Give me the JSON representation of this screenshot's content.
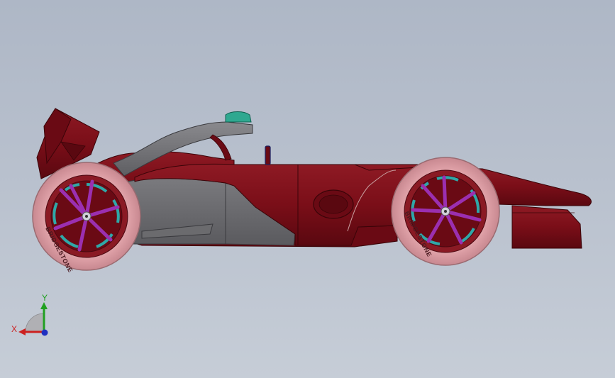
{
  "scene": {
    "subject": "formula-car-side-view"
  },
  "colors": {
    "background_top": "#aeb7c6",
    "background_bottom": "#c6cdd7",
    "body_red": "#7a0e18",
    "body_red_dark": "#5a0810",
    "body_red_highlight": "#9a2a32",
    "sidepod_gray": "#6b6b6e",
    "halo_gray": "#7c7c80",
    "tire_pink": "#e7aab0",
    "tire_pink_dark": "#c88890",
    "rim_purple": "#9b2fb0",
    "rim_teal": "#2fa8a8",
    "helmet_green": "#2fa890",
    "axis_x": "#cc2020",
    "axis_y": "#20a020",
    "axis_z": "#2030c0"
  },
  "tires": {
    "rear_brand": "BRIDGESTONE",
    "front_brand": "BRIDGESTONE"
  },
  "triad": {
    "x_label": "X",
    "y_label": "Y"
  }
}
